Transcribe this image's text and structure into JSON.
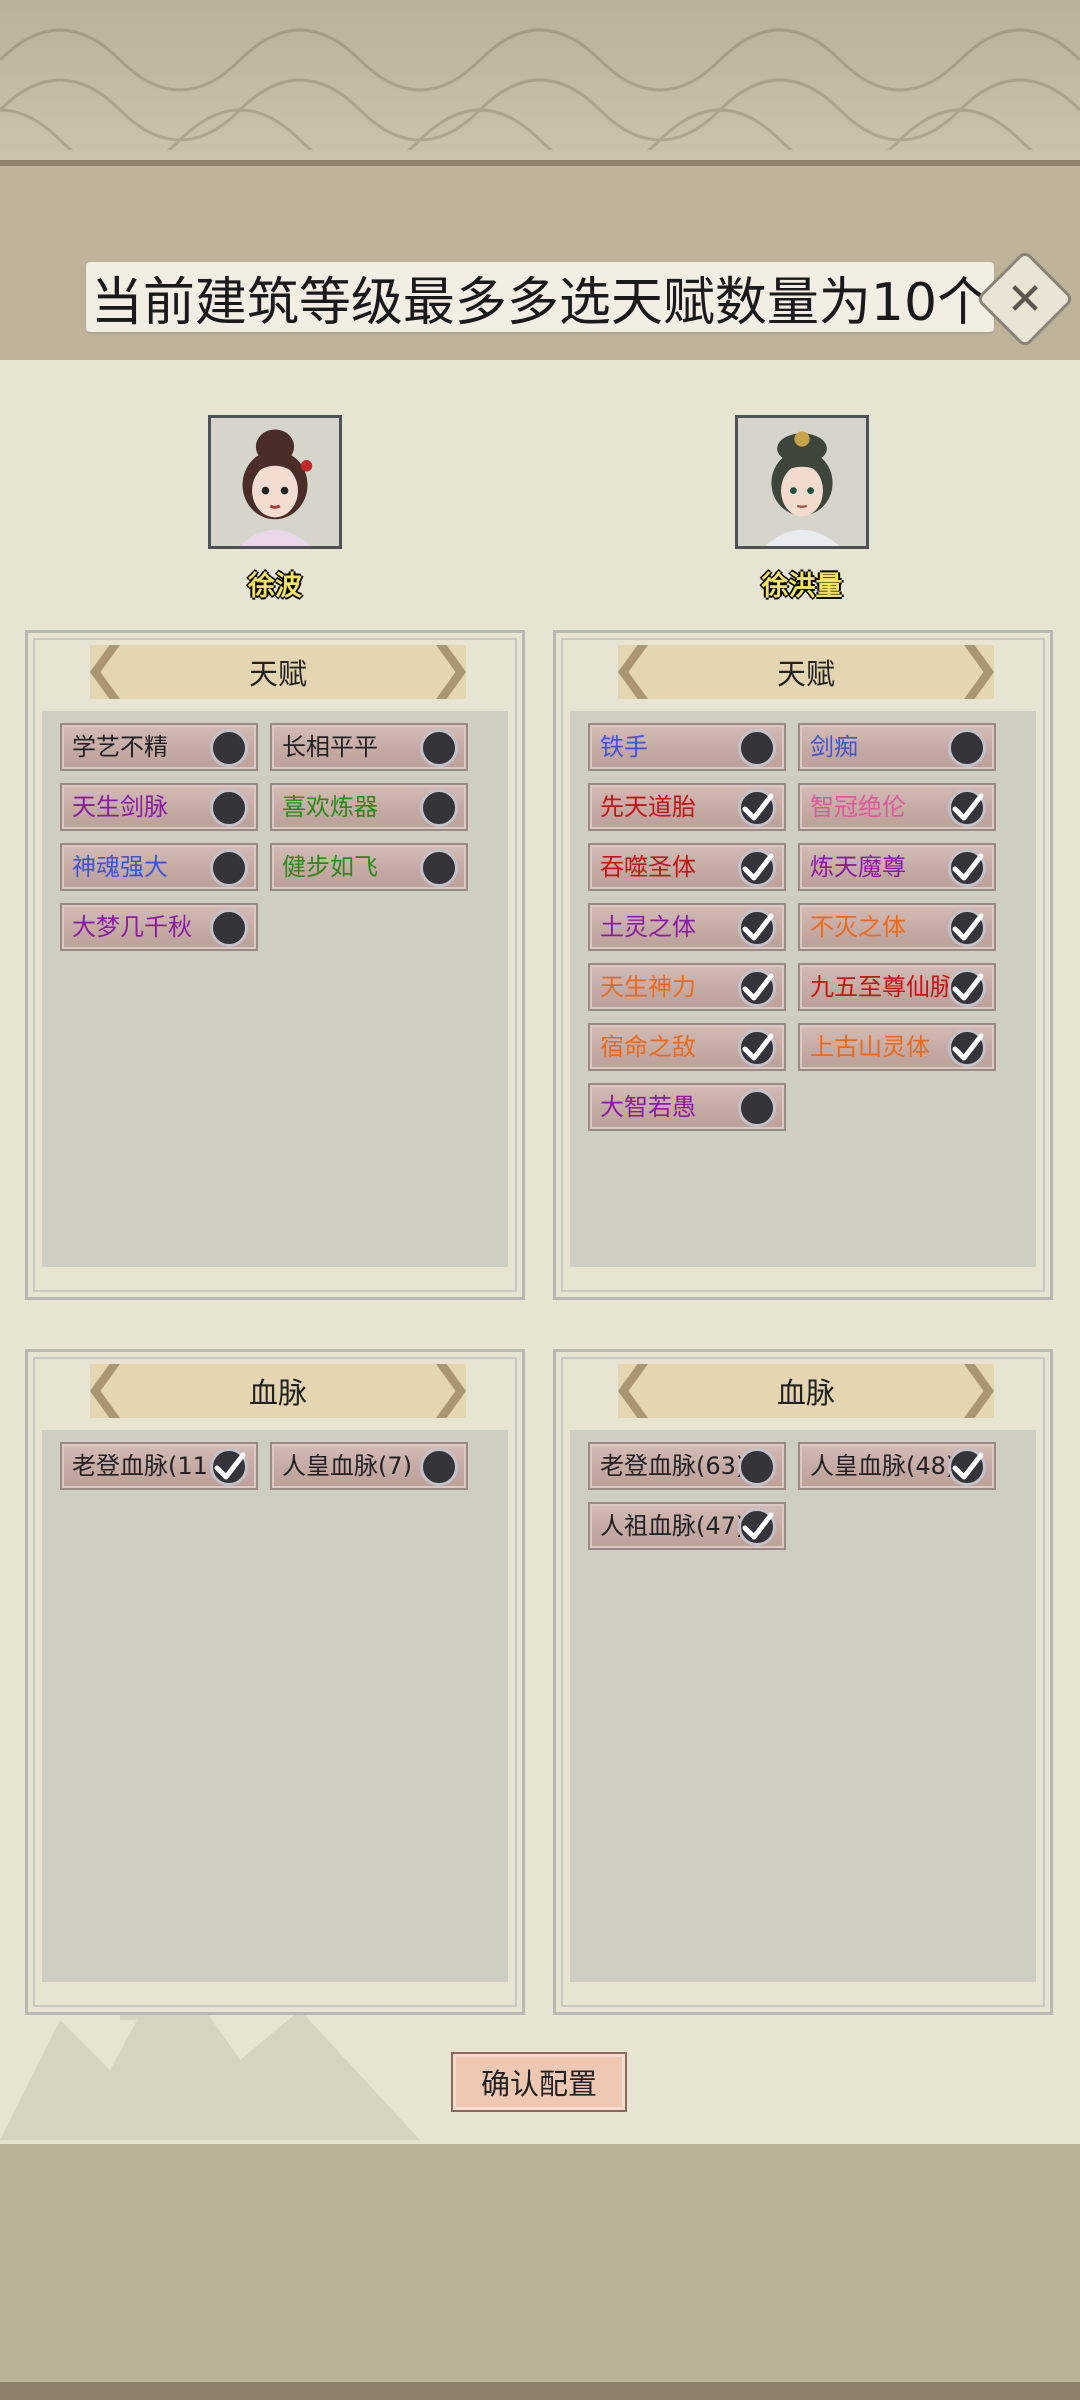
{
  "banner": {
    "text": "当前建筑等级最多多选天赋数量为10个"
  },
  "close": {
    "icon": "close-icon",
    "glyph": "✕"
  },
  "characters": [
    {
      "name": "徐波",
      "talent_header": "天赋",
      "bloodline_header": "血脉",
      "talents": [
        {
          "label": "学艺不精",
          "color": "#222222",
          "checked": false
        },
        {
          "label": "长相平平",
          "color": "#222222",
          "checked": false
        },
        {
          "label": "天生剑脉",
          "color": "#8a1aa8",
          "checked": false
        },
        {
          "label": "喜欢炼器",
          "color": "#2c8a18",
          "checked": false
        },
        {
          "label": "神魂强大",
          "color": "#3f55d8",
          "checked": false
        },
        {
          "label": "健步如飞",
          "color": "#2c8a18",
          "checked": false
        },
        {
          "label": "大梦几千秋",
          "color": "#8a1aa8",
          "checked": false
        }
      ],
      "bloodlines": [
        {
          "label": "老登血脉(11",
          "color": "#222222",
          "checked": true
        },
        {
          "label": "人皇血脉(7)",
          "color": "#222222",
          "checked": false
        }
      ]
    },
    {
      "name": "徐洪量",
      "talent_header": "天赋",
      "bloodline_header": "血脉",
      "talents": [
        {
          "label": "铁手",
          "color": "#3f55d8",
          "checked": false
        },
        {
          "label": "剑痴",
          "color": "#3f55d8",
          "checked": false
        },
        {
          "label": "先天道胎",
          "color": "#cc1111",
          "checked": true
        },
        {
          "label": "智冠绝伦",
          "color": "#e0589a",
          "checked": true
        },
        {
          "label": "吞噬圣体",
          "color": "#cc1111",
          "checked": true
        },
        {
          "label": "炼天魔尊",
          "color": "#8a1aa8",
          "checked": true
        },
        {
          "label": "土灵之体",
          "color": "#8a1aa8",
          "checked": true
        },
        {
          "label": "不灭之体",
          "color": "#ee6a1a",
          "checked": true
        },
        {
          "label": "天生神力",
          "color": "#ee6a1a",
          "checked": true
        },
        {
          "label": "九五至尊仙脉",
          "color": "#cc1111",
          "checked": true
        },
        {
          "label": "宿命之敌",
          "color": "#ee6a1a",
          "checked": true
        },
        {
          "label": "上古山灵体",
          "color": "#ee6a1a",
          "checked": true
        },
        {
          "label": "大智若愚",
          "color": "#8a1aa8",
          "checked": false
        }
      ],
      "bloodlines": [
        {
          "label": "老登血脉(63)",
          "color": "#222222",
          "checked": false
        },
        {
          "label": "人皇血脉(48)",
          "color": "#222222",
          "checked": true
        },
        {
          "label": "人祖血脉(47)",
          "color": "#222222",
          "checked": true
        }
      ]
    }
  ],
  "confirm": {
    "label": "确认配置"
  }
}
